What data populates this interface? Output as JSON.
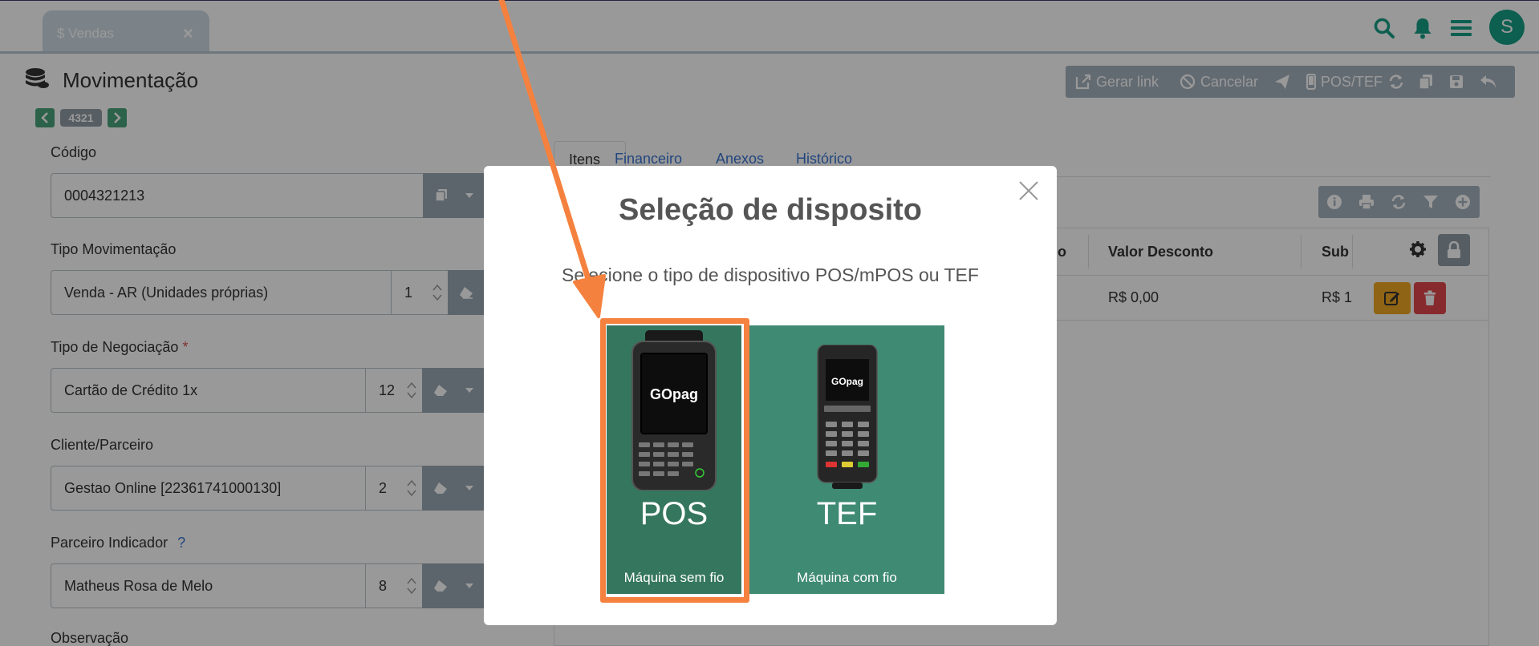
{
  "top_tab": {
    "label": "$ Vendas",
    "close": "×"
  },
  "header": {
    "avatar_letter": "S"
  },
  "page": {
    "title": "Movimentação",
    "record_number": "4321"
  },
  "toolbar": {
    "gerar_link": "Gerar link",
    "cancelar": "Cancelar",
    "pos_tef": "POS/TEF"
  },
  "form": {
    "codigo": {
      "label": "Código",
      "value": "0004321213"
    },
    "tipo_movimentacao": {
      "label": "Tipo Movimentação",
      "value": "Venda - AR (Unidades próprias)",
      "number": "1"
    },
    "tipo_negociacao": {
      "label": "Tipo de Negociação",
      "required_mark": "*",
      "value": "Cartão de Crédito 1x",
      "number": "12"
    },
    "cliente": {
      "label": "Cliente/Parceiro",
      "value": "Gestao Online [22361741000130]",
      "number": "2"
    },
    "parceiro_indicador": {
      "label": "Parceiro Indicador",
      "help": "?",
      "value": "Matheus Rosa de Melo",
      "number": "8"
    },
    "observacao": {
      "label": "Observação"
    }
  },
  "panel": {
    "tabs": [
      "Itens",
      "Financeiro",
      "Anexos",
      "Histórico"
    ],
    "columns": {
      "partial": "o",
      "valor_desconto": "Valor Desconto",
      "sub": "Sub"
    },
    "row": {
      "valor_desconto": "R$ 0,00",
      "sub": "R$ 1"
    }
  },
  "modal": {
    "title": "Seleção de disposito",
    "subtitle": "Selecione o tipo de dispositivo POS/mPOS ou TEF",
    "options": [
      {
        "name": "POS",
        "caption": "Máquina sem fio"
      },
      {
        "name": "TEF",
        "caption": "Máquina com fio"
      }
    ],
    "device_brand": "GOpag"
  },
  "colors": {
    "accent": "#169e85",
    "card": "#3f8a72",
    "card_selected": "#35765f",
    "highlight": "#f5813f"
  },
  "icons": [
    "search-icon",
    "bell-icon",
    "menu-icon",
    "coins-icon",
    "link-icon",
    "ban-icon",
    "send-icon",
    "mobile-icon",
    "refresh-icon",
    "copy-icon",
    "save-icon",
    "undo-icon",
    "eraser-icon",
    "info-icon",
    "print-icon",
    "filter-icon",
    "plus-icon",
    "gear-icon",
    "lock-icon",
    "edit-icon",
    "trash-icon",
    "close-icon"
  ]
}
